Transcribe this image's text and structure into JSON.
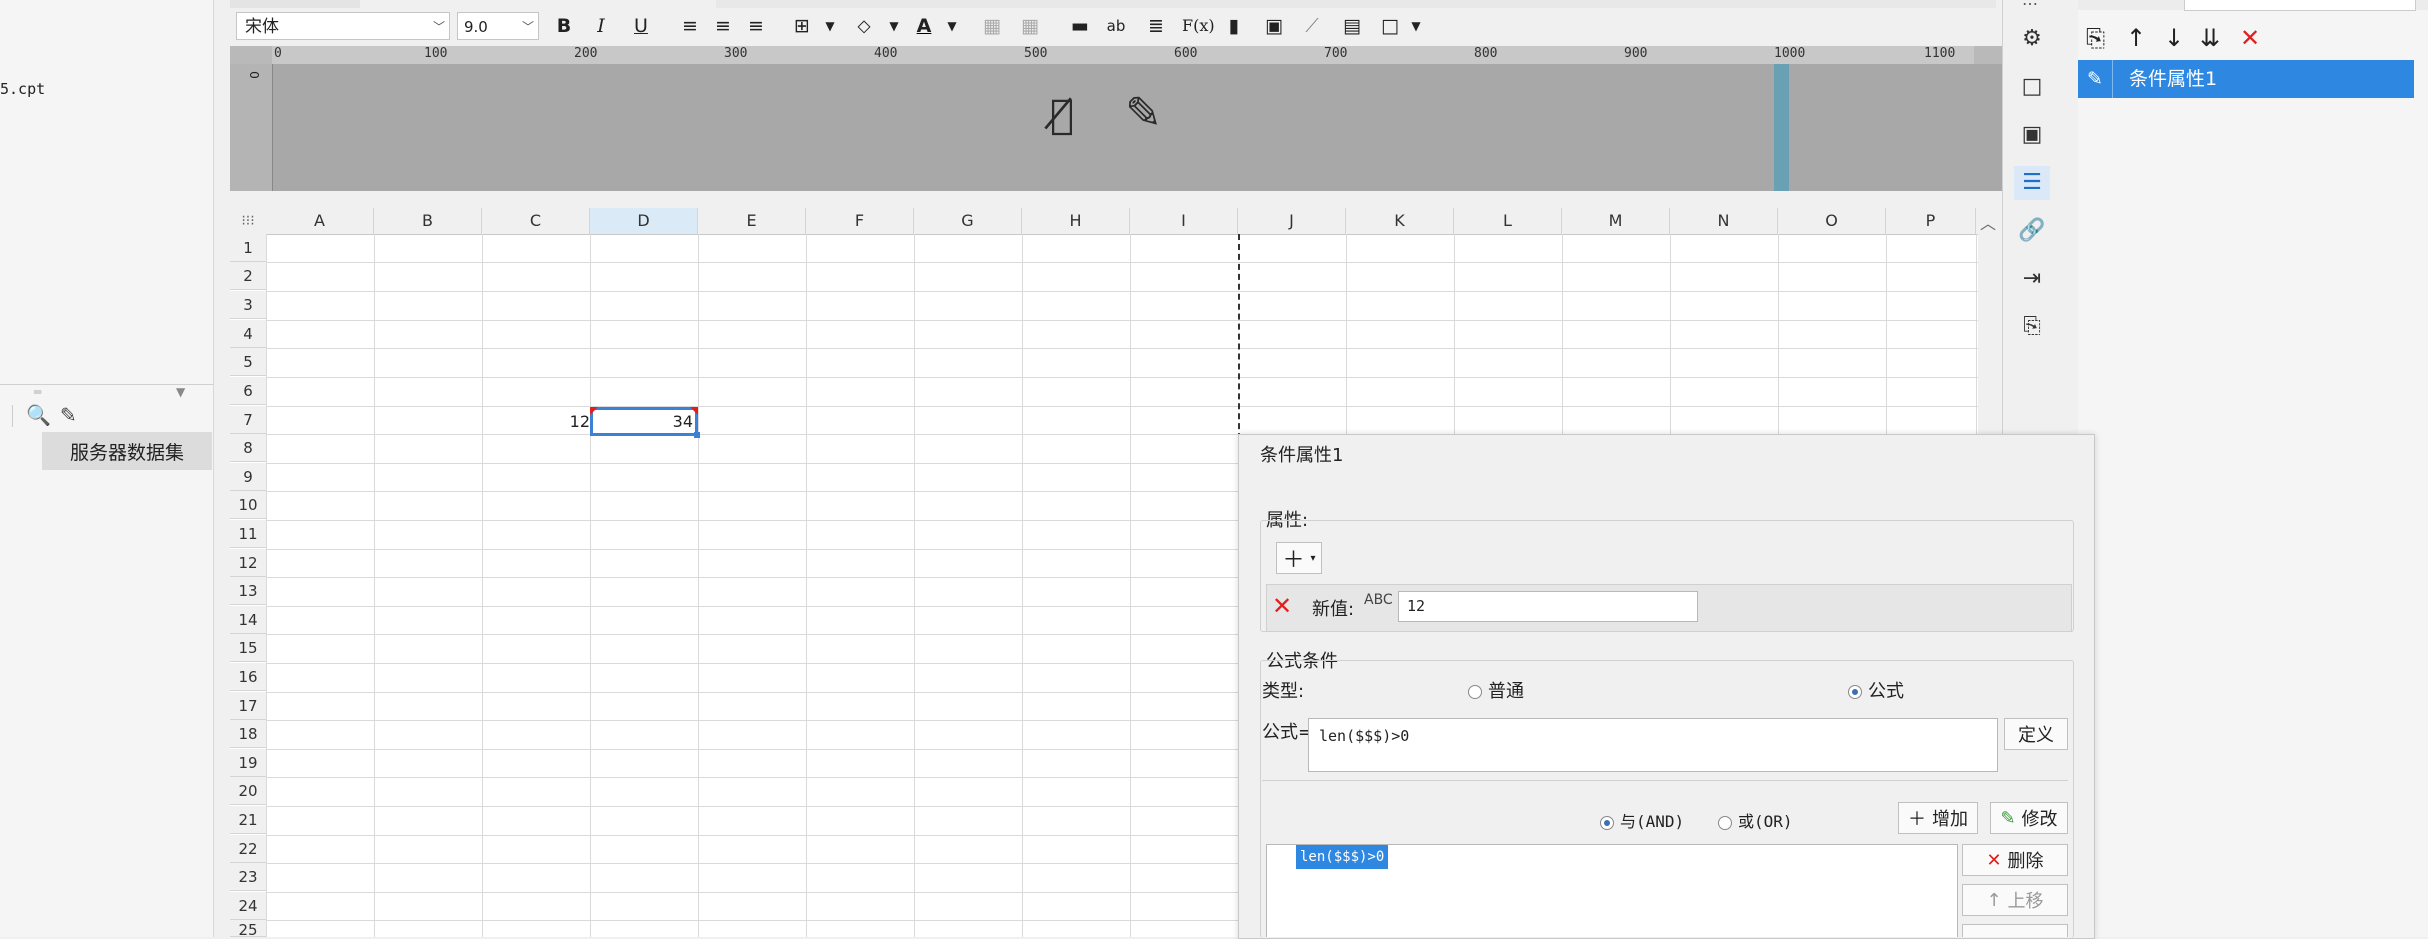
{
  "left_panel": {
    "file_name": "5.cpt",
    "dataset_tab": "服务器数据集"
  },
  "toolbar": {
    "font_family": "宋体",
    "font_size": "9.0",
    "bold": "B",
    "italic": "I",
    "underline": "U",
    "formula": "F(x)",
    "text_ab": "ab"
  },
  "ruler": {
    "ticks": [
      "0",
      "100",
      "200",
      "300",
      "400",
      "500",
      "600",
      "700",
      "800",
      "900",
      "1000",
      "1100"
    ]
  },
  "grid": {
    "columns": [
      "A",
      "B",
      "C",
      "D",
      "E",
      "F",
      "G",
      "H",
      "I",
      "J",
      "K",
      "L",
      "M",
      "N",
      "O",
      "P"
    ],
    "selected_column": "D",
    "rows": [
      "1",
      "2",
      "3",
      "4",
      "5",
      "6",
      "7",
      "8",
      "9",
      "10",
      "11",
      "12",
      "13",
      "14",
      "15",
      "16",
      "17",
      "18",
      "19",
      "20",
      "21",
      "22",
      "23",
      "24",
      "25"
    ],
    "cell_c7": "12",
    "cell_d7": "34"
  },
  "right_panel": {
    "condition_item": "条件属性1"
  },
  "dialog": {
    "title": "条件属性1",
    "attributes_label": "属性:",
    "new_value_label": "新值:",
    "new_value": "12",
    "formula_condition_label": "公式条件",
    "type_label": "类型:",
    "type_normal": "普通",
    "type_formula": "公式",
    "formula_label": "公式=",
    "formula_value": "len($$$)>0",
    "define_button": "定义",
    "and_label": "与(AND)",
    "or_label": "或(OR)",
    "add_button": "增加",
    "modify_button": "修改",
    "condition_entry": "len($$$)>0",
    "delete_button": "删除",
    "move_up_button": "上移"
  },
  "colors": {
    "accent": "#2e87e0",
    "selection_border": "#3b82d6",
    "delete_red": "#e02020"
  }
}
